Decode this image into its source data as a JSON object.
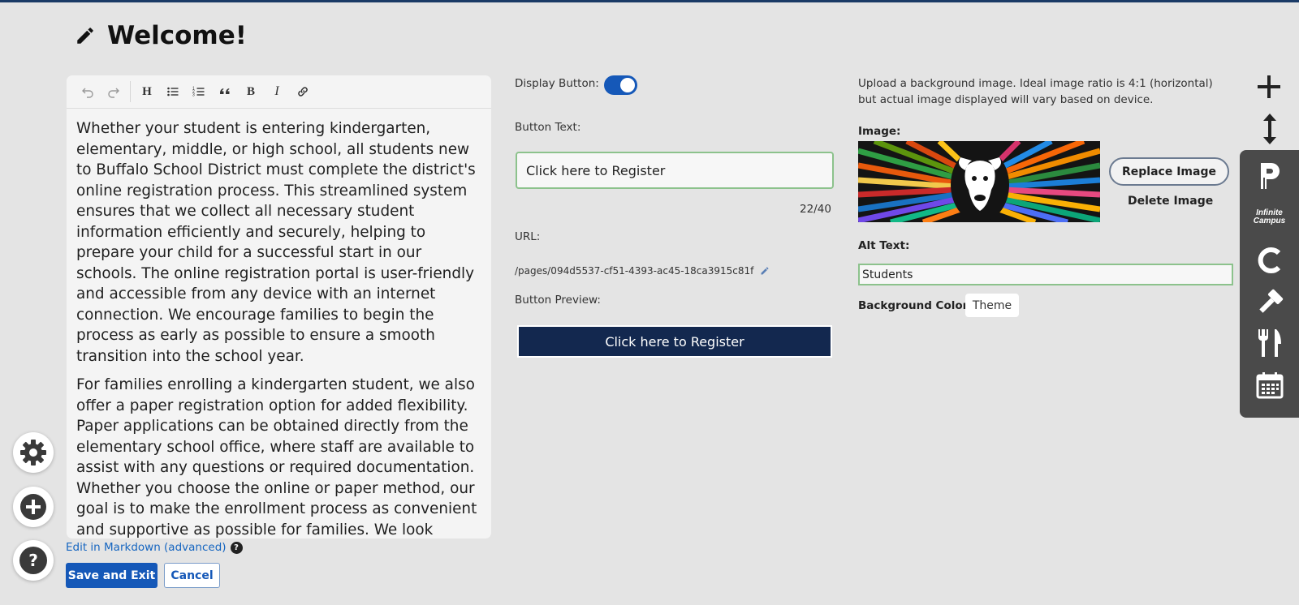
{
  "page": {
    "title": "Welcome!",
    "title_icon": "pencil-icon"
  },
  "editor": {
    "toolbar": {
      "undo": "undo-icon",
      "redo": "redo-icon",
      "heading": "H",
      "bullet_list": "bullet-list-icon",
      "numbered_list": "numbered-list-icon",
      "quote": "quote-icon",
      "bold": "B",
      "italic": "I",
      "link": "link-icon"
    },
    "paragraphs": [
      "Whether your student is entering kindergarten, elementary, middle, or high school, all students new to Buffalo School District must complete the district's online registration process. This streamlined system ensures that we collect all necessary student information efficiently and securely, helping to prepare your child for a successful start in our schools. The online registration portal is user-friendly and accessible from any device with an internet connection. We encourage families to begin the process as early as possible to ensure a smooth transition into the school year.",
      "For families enrolling a kindergarten student, we also offer a paper registration option for added flexibility. Paper applications can be obtained directly from the elementary school office, where staff are available to assist with any questions or required documentation. Whether you choose the online or paper method, our goal is to make the enrollment process as convenient and supportive as possible for families. We look forward to welcoming your student into the Buffalo School District community!"
    ],
    "markdown_link": "Edit in Markdown (advanced)",
    "markdown_help": "?",
    "save_label": "Save and Exit",
    "cancel_label": "Cancel"
  },
  "button_settings": {
    "display_label": "Display Button:",
    "display_on": true,
    "text_label": "Button Text:",
    "text_value": "Click here to Register",
    "char_count": "22/40",
    "url_label": "URL:",
    "url_value": "/pages/094d5537-cf51-4393-ac45-18ca3915c81f",
    "preview_label": "Button Preview:",
    "preview_text": "Click here to Register",
    "preview_color": "#13284f"
  },
  "background": {
    "upload_note": "Upload a background image. Ideal image ratio is 4:1 (horizontal) but actual image displayed will vary based on device.",
    "image_label": "Image:",
    "replace_label": "Replace Image",
    "delete_label": "Delete Image",
    "alt_label": "Alt Text:",
    "alt_value": "Students",
    "color_label": "Background Color:",
    "color_value": "Theme"
  },
  "dock": {
    "add": "plus-icon",
    "move": "vertical-arrows-icon",
    "apps": [
      "parentsquare-icon",
      "infinite-campus-icon",
      "c-app-icon",
      "gavel-icon",
      "fork-knife-icon",
      "calendar-icon"
    ],
    "infinite_campus_line1": "Infinite",
    "infinite_campus_line2": "Campus"
  },
  "floating": {
    "settings": "gear-icon",
    "add": "plus-circle-icon",
    "help": "?"
  },
  "colors": {
    "primary": "#1558b8",
    "preview_button": "#13284f",
    "dock": "#4a4a4a",
    "valid_border": "#8cc28c"
  }
}
